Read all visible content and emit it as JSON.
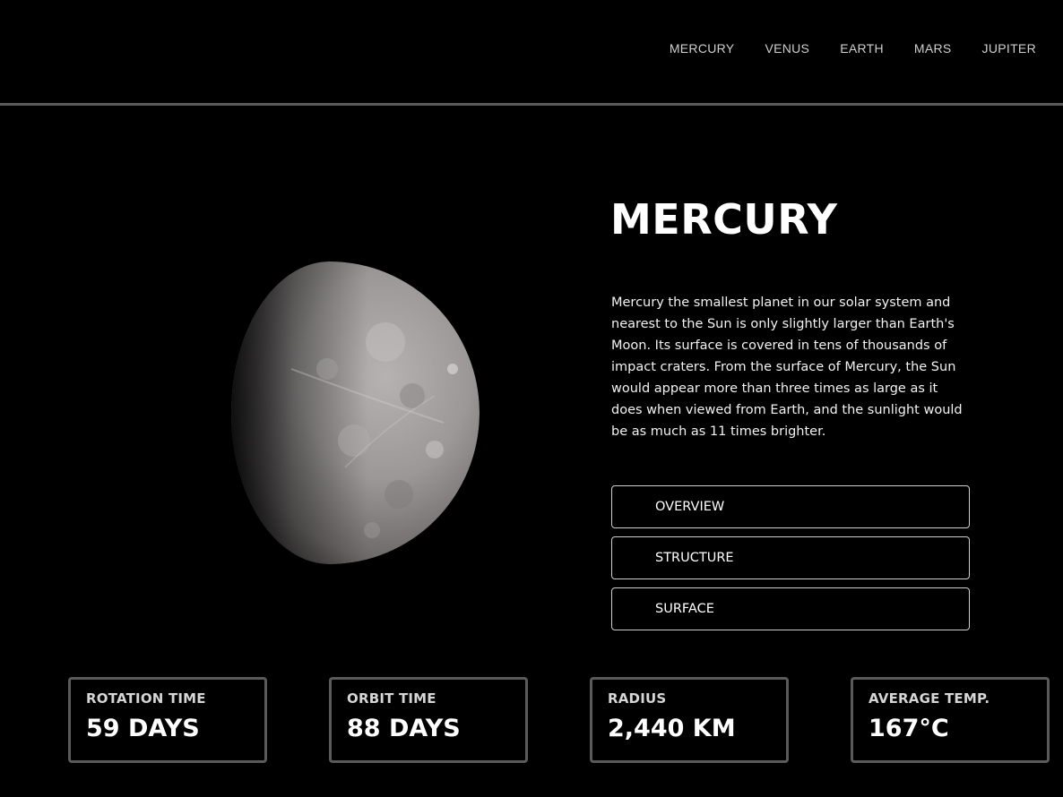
{
  "nav": {
    "items": [
      "MERCURY",
      "VENUS",
      "EARTH",
      "MARS",
      "JUPITER"
    ]
  },
  "planet": {
    "name": "MERCURY",
    "image": "mercury-planet-image",
    "description": "Mercury the smallest planet in our solar system and nearest to the Sun is only slightly larger than Earth's Moon. Its surface is covered in tens of thousands of impact craters. From the surface of Mercury, the Sun would appear more than three times as large as it does when viewed from Earth, and the sunlight would be as much as 11 times brighter."
  },
  "tabs": [
    {
      "label": "OVERVIEW"
    },
    {
      "label": "STRUCTURE"
    },
    {
      "label": "SURFACE"
    }
  ],
  "stats": [
    {
      "label": "ROTATION TIME",
      "value": "59 DAYS"
    },
    {
      "label": "ORBIT TIME",
      "value": "88 DAYS"
    },
    {
      "label": "RADIUS",
      "value": "2,440 KM"
    },
    {
      "label": "AVERAGE TEMP.",
      "value": "167°C"
    }
  ],
  "colors": {
    "background": "#000000",
    "divider": "#5a5a5a",
    "nav_text": "#cfcfcf",
    "tab_border": "#cfcfcf",
    "stat_border": "#5a5a5a"
  }
}
